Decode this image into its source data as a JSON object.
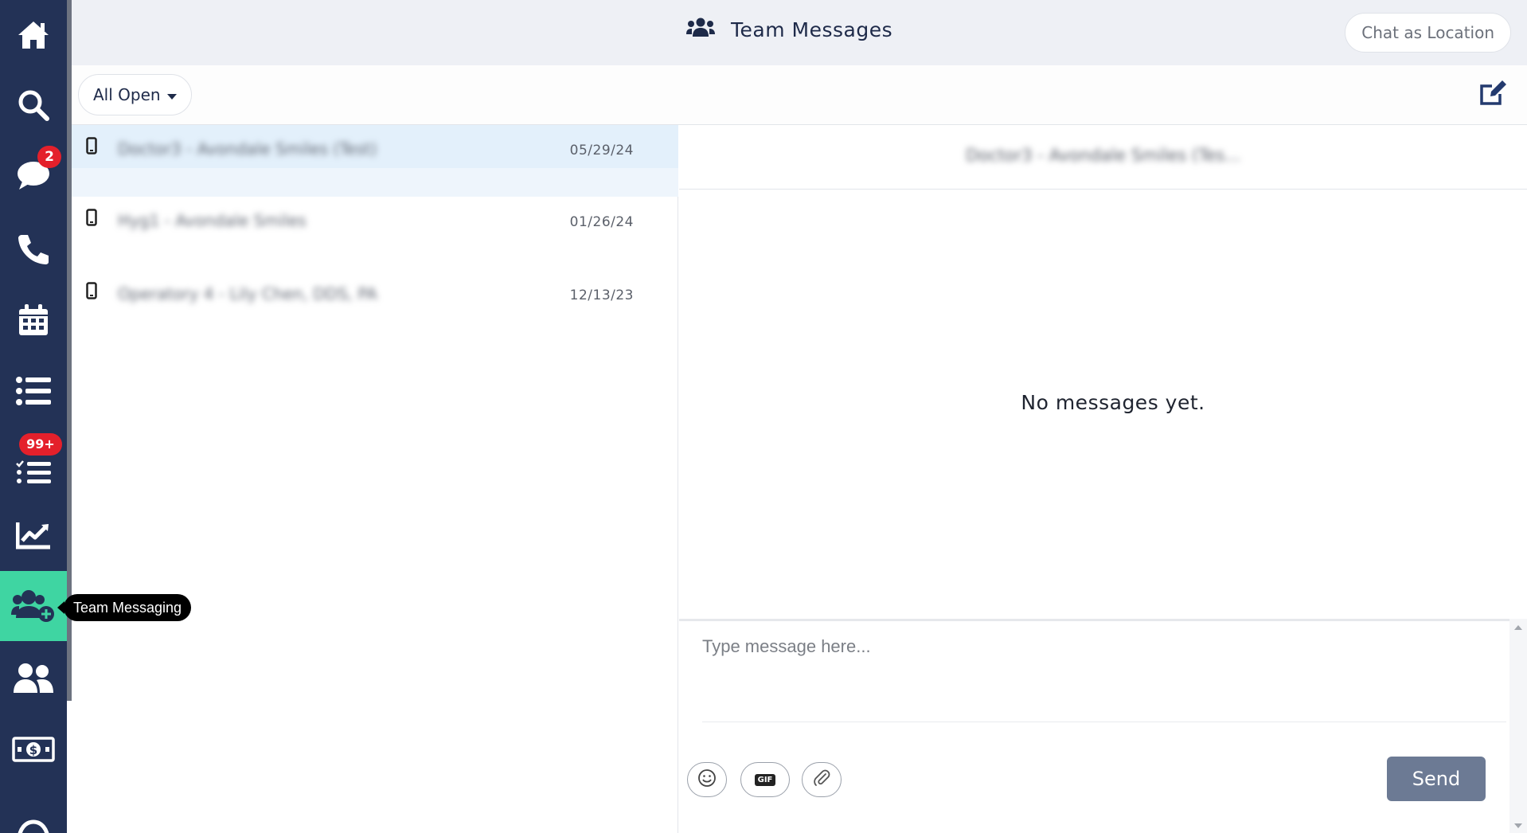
{
  "header": {
    "title": "Team Messages",
    "chat_as_location_label": "Chat as Location",
    "icon": "users-icon"
  },
  "sidebar": {
    "items": [
      {
        "name": "home",
        "icon": "home-icon"
      },
      {
        "name": "search",
        "icon": "search-icon"
      },
      {
        "name": "messages",
        "icon": "chat-icon",
        "badge": "2"
      },
      {
        "name": "calls",
        "icon": "phone-icon"
      },
      {
        "name": "calendar",
        "icon": "calendar-icon"
      },
      {
        "name": "list",
        "icon": "list-icon"
      },
      {
        "name": "tasks",
        "icon": "checklist-icon",
        "badge": "99+"
      },
      {
        "name": "reports",
        "icon": "chart-line-icon"
      },
      {
        "name": "team-messaging",
        "icon": "users-plus-icon",
        "active": true
      },
      {
        "name": "contacts",
        "icon": "users-icon"
      },
      {
        "name": "payments",
        "icon": "money-icon"
      },
      {
        "name": "support",
        "icon": "headset-icon"
      }
    ],
    "tooltip": "Team Messaging",
    "active_color": "#3fd5a2",
    "bg_color": "#233256"
  },
  "filter": {
    "label": "All Open",
    "compose_icon": "edit-icon"
  },
  "conversations": [
    {
      "name": "Doctor3 - Avondale Smiles (Test)",
      "date": "05/29/24",
      "selected": true
    },
    {
      "name": "Hyg1 - Avondale Smiles",
      "date": "01/26/24",
      "selected": false
    },
    {
      "name": "Operatory 4 - Lily Chen, DDS, PA",
      "date": "12/13/23",
      "selected": false
    }
  ],
  "chat": {
    "header_name": "Doctor3 - Avondale Smiles (Tes...",
    "empty_text": "No messages yet.",
    "input_placeholder": "Type message here...",
    "send_label": "Send",
    "gif_label": "GIF"
  }
}
